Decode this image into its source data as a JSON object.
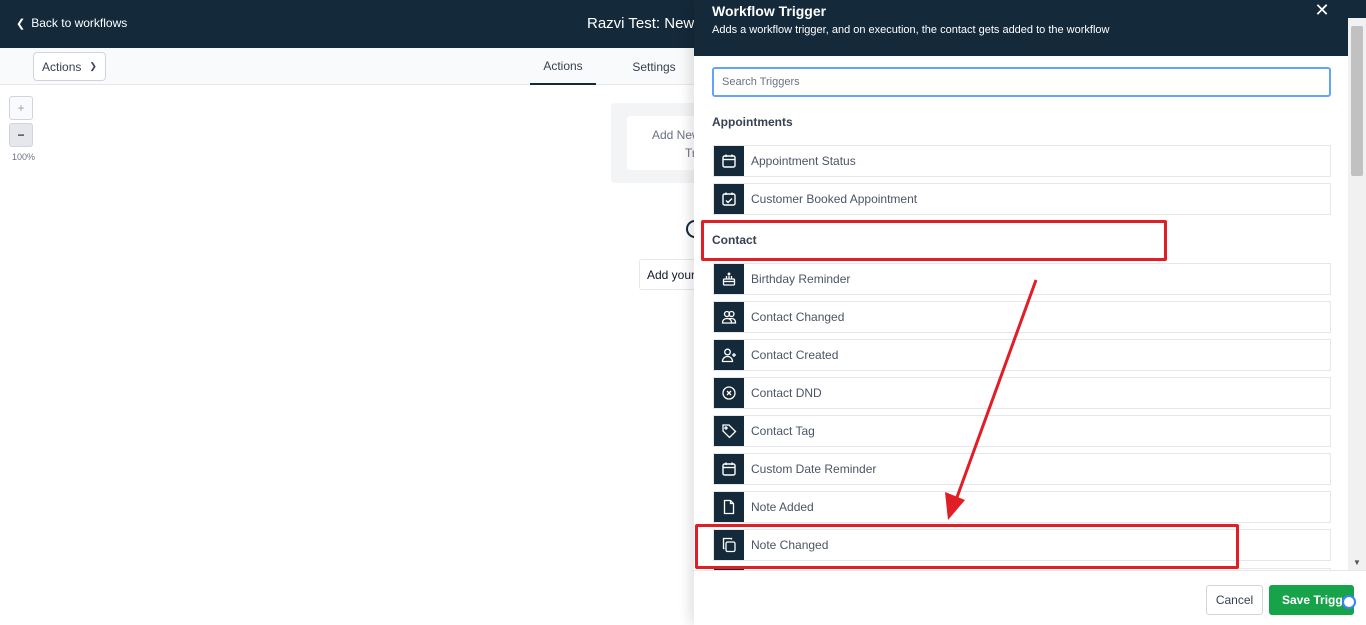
{
  "topbar": {
    "back_label": "Back to workflows",
    "title": "Razvi Test: New W"
  },
  "subbar": {
    "actions_dropdown": "Actions",
    "tabs": [
      {
        "label": "Actions",
        "active": true
      },
      {
        "label": "Settings",
        "active": false
      }
    ]
  },
  "canvas": {
    "zoom_in": "+",
    "zoom_out": "−",
    "zoom_level": "100%",
    "trigger_line1": "Add New",
    "trigger_line2": "Tr",
    "add_action": "Add your"
  },
  "drawer": {
    "title": "Workflow Trigger",
    "subtitle": "Adds a workflow trigger, and on execution, the contact gets added to the workflow",
    "close": "✕",
    "search_placeholder": "Search Triggers",
    "sections": [
      {
        "label": "Appointments",
        "items": [
          {
            "label": "Appointment Status",
            "icon": "calendar-icon"
          },
          {
            "label": "Customer Booked Appointment",
            "icon": "calendar-check-icon"
          }
        ]
      },
      {
        "label": "Contact",
        "items": [
          {
            "label": "Birthday Reminder",
            "icon": "cake-icon"
          },
          {
            "label": "Contact Changed",
            "icon": "users-icon"
          },
          {
            "label": "Contact Created",
            "icon": "user-plus-icon"
          },
          {
            "label": "Contact DND",
            "icon": "circle-x-icon"
          },
          {
            "label": "Contact Tag",
            "icon": "tag-icon"
          },
          {
            "label": "Custom Date Reminder",
            "icon": "calendar-icon"
          },
          {
            "label": "Note Added",
            "icon": "file-icon"
          },
          {
            "label": "Note Changed",
            "icon": "copy-icon"
          }
        ]
      }
    ],
    "footer": {
      "cancel": "Cancel",
      "save": "Save Trigger"
    }
  },
  "colors": {
    "header": "#14293a",
    "accent_save": "#16a34a",
    "search_focus": "#60a5fa",
    "annotation": "#e11d26"
  }
}
